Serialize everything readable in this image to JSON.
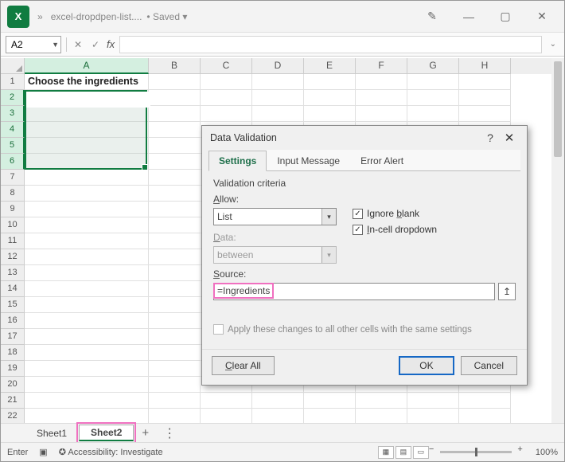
{
  "titlebar": {
    "filename": "excel-dropdpen-list....",
    "saved_status": "Saved"
  },
  "formula_bar": {
    "namebox_value": "A2",
    "fx_label": "fx",
    "formula_value": ""
  },
  "columns": [
    "A",
    "B",
    "C",
    "D",
    "E",
    "F",
    "G",
    "H"
  ],
  "rows_count": 22,
  "selected_rows": [
    2,
    3,
    4,
    5,
    6
  ],
  "sheet_data": {
    "A1": "Choose the ingredients"
  },
  "sheet_tabs": {
    "tabs": [
      "Sheet1",
      "Sheet2"
    ],
    "active": "Sheet2"
  },
  "status_bar": {
    "mode": "Enter",
    "accessibility": "Accessibility: Investigate",
    "zoom": "100%"
  },
  "dialog": {
    "title": "Data Validation",
    "tabs": [
      "Settings",
      "Input Message",
      "Error Alert"
    ],
    "active_tab": "Settings",
    "criteria_label": "Validation criteria",
    "allow_label": "Allow:",
    "allow_value": "List",
    "data_label": "Data:",
    "data_value": "between",
    "source_label": "Source:",
    "source_value": "=Ingredients",
    "ignore_blank_label": "Ignore blank",
    "ignore_blank_checked": true,
    "incell_label": "In-cell dropdown",
    "incell_checked": true,
    "apply_label": "Apply these changes to all other cells with the same settings",
    "apply_checked": false,
    "buttons": {
      "clear_all": "Clear All",
      "ok": "OK",
      "cancel": "Cancel"
    }
  }
}
